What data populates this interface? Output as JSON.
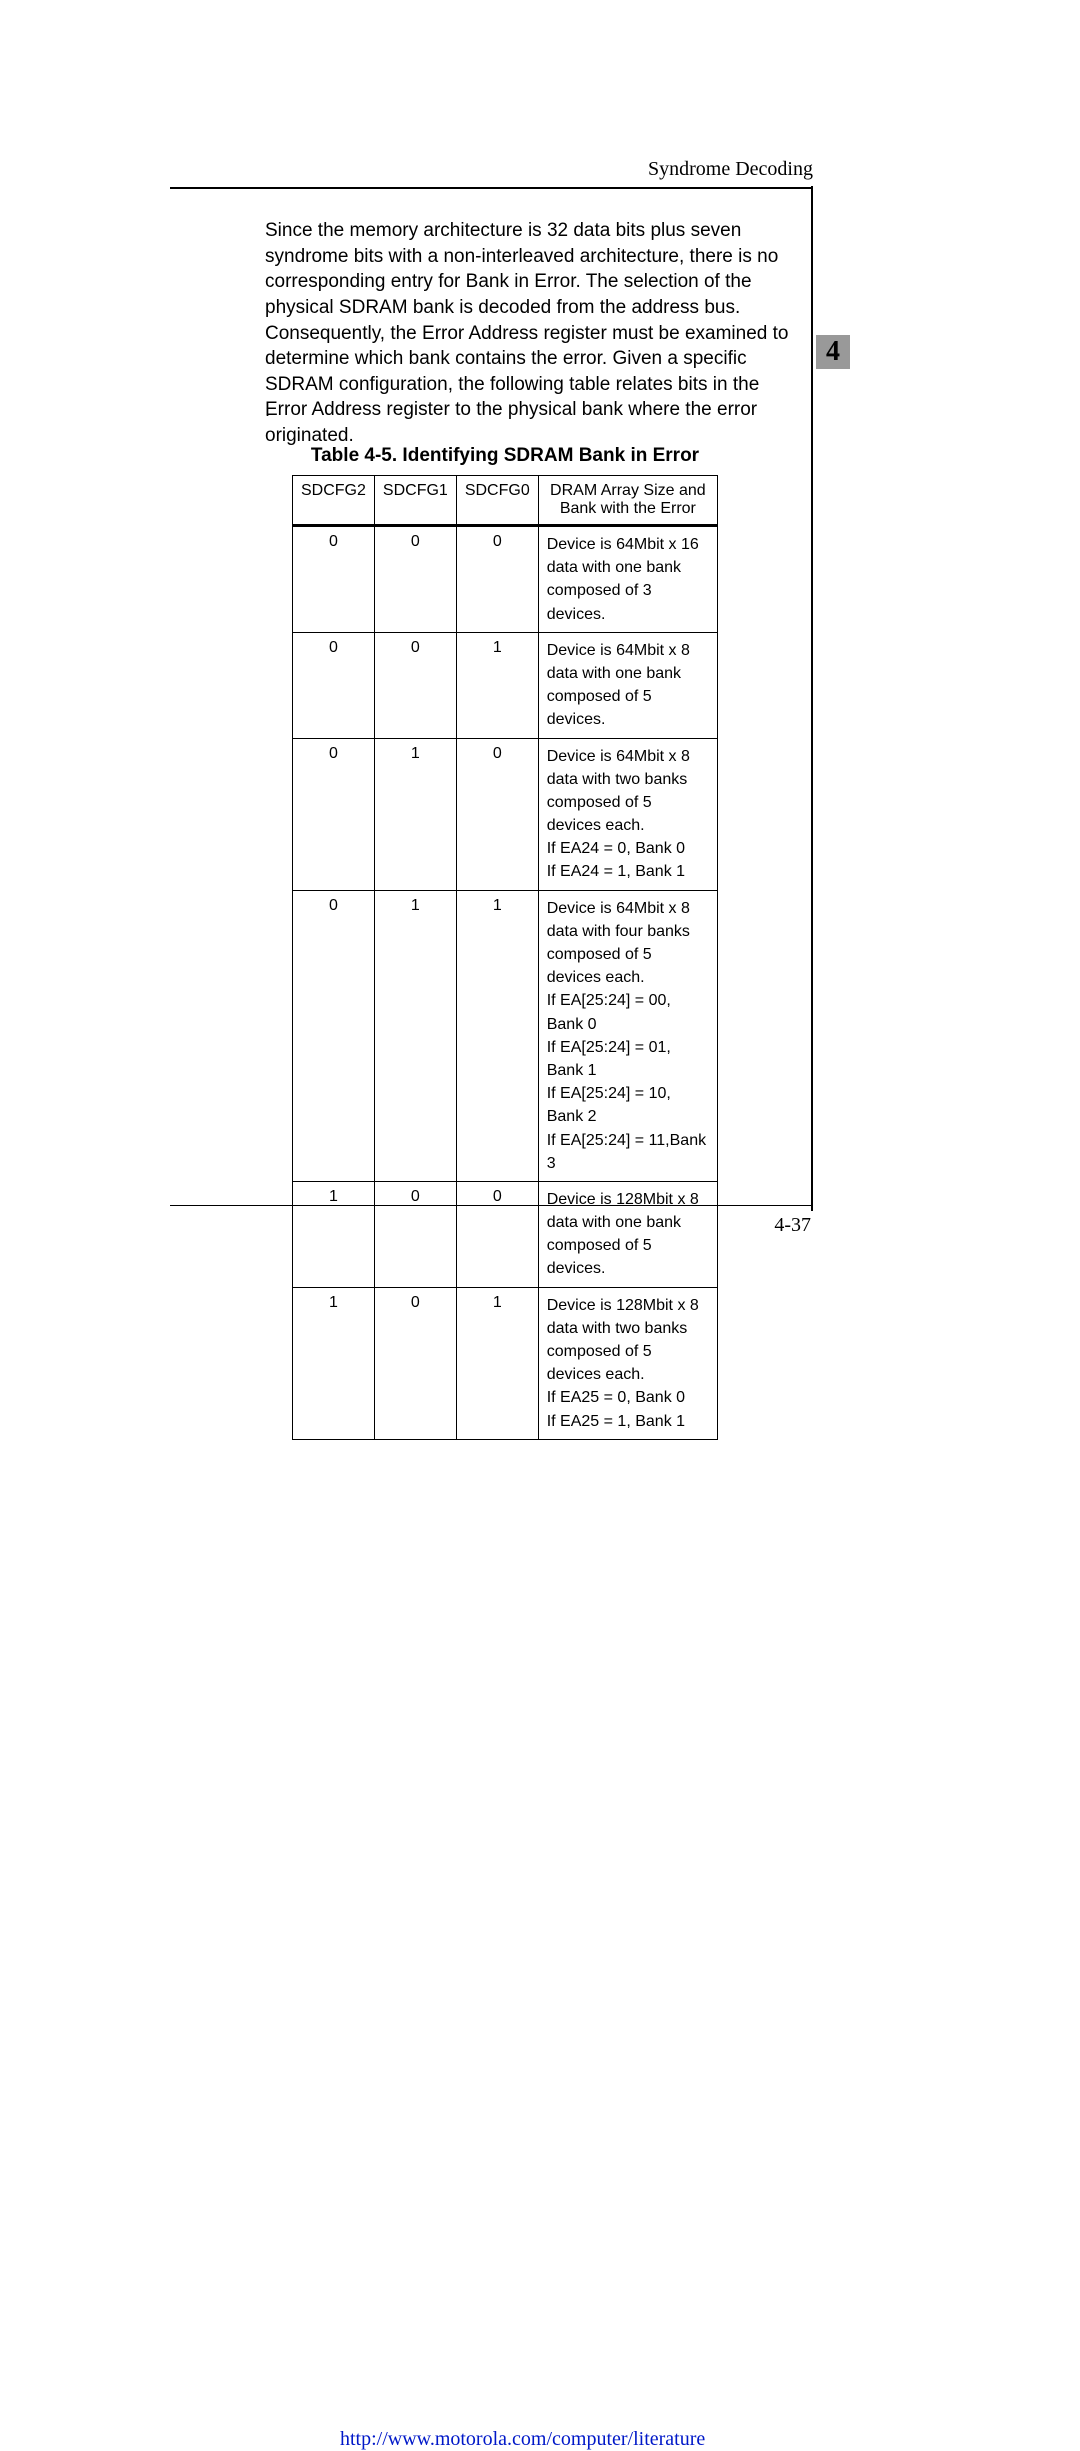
{
  "header": {
    "section_title": "Syndrome Decoding"
  },
  "chapter_tab": "4",
  "body": {
    "paragraph": "Since the memory architecture is 32 data bits plus seven syndrome bits with a non-interleaved architecture, there is no corresponding entry for Bank in Error. The selection of the physical SDRAM bank is decoded from the address bus. Consequently, the Error Address register must be examined to determine which bank contains the error. Given a specific SDRAM configuration, the following table relates bits in the Error Address register to the physical bank where the error originated.",
    "period_mark": "."
  },
  "table": {
    "caption": "Table 4-5.  Identifying SDRAM Bank in Error",
    "headers": [
      "SDCFG2",
      "SDCFG1",
      "SDCFG0",
      "DRAM Array Size and Bank with the Error"
    ],
    "rows": [
      {
        "sdcfg2": "0",
        "sdcfg1": "0",
        "sdcfg0": "0",
        "desc": [
          "Device is 64Mbit x 16 data with one bank composed of 3 devices."
        ]
      },
      {
        "sdcfg2": "0",
        "sdcfg1": "0",
        "sdcfg0": "1",
        "desc": [
          "Device is 64Mbit x 8  data with one bank composed of 5 devices."
        ]
      },
      {
        "sdcfg2": "0",
        "sdcfg1": "1",
        "sdcfg0": "0",
        "desc": [
          "Device is 64Mbit x 8  data with two banks composed of 5 devices each.",
          "If EA24 = 0, Bank 0",
          "If EA24 = 1, Bank 1"
        ]
      },
      {
        "sdcfg2": "0",
        "sdcfg1": "1",
        "sdcfg0": "1",
        "desc": [
          "Device is 64Mbit x 8  data with four banks composed of 5 devices each.",
          "If EA[25:24] = 00, Bank 0",
          "If EA[25:24] = 01, Bank 1",
          "If EA[25:24] = 10, Bank 2",
          "If EA[25:24] = 11,Bank 3"
        ]
      },
      {
        "sdcfg2": "1",
        "sdcfg1": "0",
        "sdcfg0": "0",
        "desc": [
          "Device is 128Mbit x 8  data with one bank composed of 5 devices."
        ]
      },
      {
        "sdcfg2": "1",
        "sdcfg1": "0",
        "sdcfg0": "1",
        "desc": [
          "Device is 128Mbit x 8  data with two banks composed of 5 devices each.",
          "If EA25 = 0, Bank 0",
          "If EA25 = 1, Bank 1"
        ]
      }
    ]
  },
  "footer": {
    "link_text": "http://www.motorola.com/computer/literature",
    "page_number": "4-37"
  }
}
